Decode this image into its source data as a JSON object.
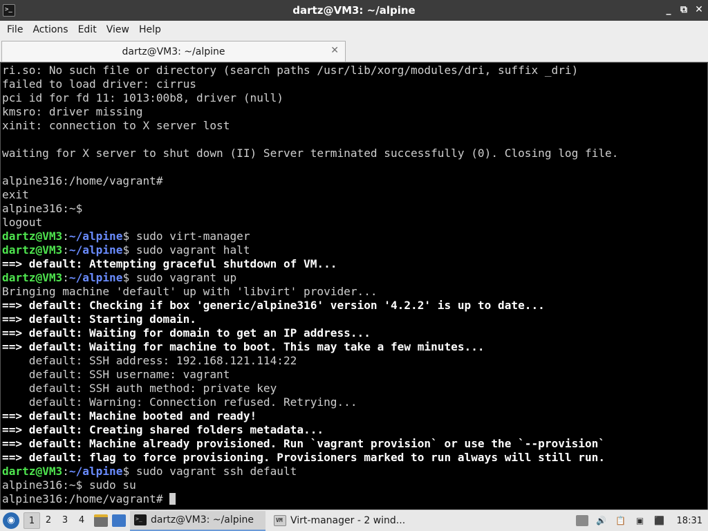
{
  "window": {
    "title": "dartz@VM3: ~/alpine",
    "app_icon_glyph": ">_",
    "controls": [
      "_",
      "⧉",
      "✕"
    ]
  },
  "menu": [
    "File",
    "Actions",
    "Edit",
    "View",
    "Help"
  ],
  "tab": {
    "label": "dartz@VM3: ~/alpine",
    "close": "✕"
  },
  "terminal": {
    "lines": [
      {
        "style": "plain",
        "text": "ri.so: No such file or directory (search paths /usr/lib/xorg/modules/dri, suffix _dri)"
      },
      {
        "style": "plain",
        "text": "failed to load driver: cirrus"
      },
      {
        "style": "plain",
        "text": "pci id for fd 11: 1013:00b8, driver (null)"
      },
      {
        "style": "plain",
        "text": "kmsro: driver missing"
      },
      {
        "style": "plain",
        "text": "xinit: connection to X server lost"
      },
      {
        "style": "plain",
        "text": ""
      },
      {
        "style": "plain",
        "text": "waiting for X server to shut down (II) Server terminated successfully (0). Closing log file."
      },
      {
        "style": "plain",
        "text": ""
      },
      {
        "style": "plain",
        "text": "alpine316:/home/vagrant#"
      },
      {
        "style": "plain",
        "text": "exit"
      },
      {
        "style": "plain",
        "text": "alpine316:~$"
      },
      {
        "style": "plain",
        "text": "logout"
      },
      {
        "style": "prompt",
        "user": "dartz@VM3",
        "path": "~/alpine",
        "cmd": "$ sudo virt-manager"
      },
      {
        "style": "prompt",
        "user": "dartz@VM3",
        "path": "~/alpine",
        "cmd": "$ sudo vagrant halt"
      },
      {
        "style": "bold",
        "text": "==> default: Attempting graceful shutdown of VM..."
      },
      {
        "style": "prompt",
        "user": "dartz@VM3",
        "path": "~/alpine",
        "cmd": "$ sudo vagrant up"
      },
      {
        "style": "plain",
        "text": "Bringing machine 'default' up with 'libvirt' provider..."
      },
      {
        "style": "bold",
        "text": "==> default: Checking if box 'generic/alpine316' version '4.2.2' is up to date..."
      },
      {
        "style": "bold",
        "text": "==> default: Starting domain."
      },
      {
        "style": "bold",
        "text": "==> default: Waiting for domain to get an IP address..."
      },
      {
        "style": "bold",
        "text": "==> default: Waiting for machine to boot. This may take a few minutes..."
      },
      {
        "style": "plain",
        "text": "    default: SSH address: 192.168.121.114:22"
      },
      {
        "style": "plain",
        "text": "    default: SSH username: vagrant"
      },
      {
        "style": "plain",
        "text": "    default: SSH auth method: private key"
      },
      {
        "style": "plain",
        "text": "    default: Warning: Connection refused. Retrying..."
      },
      {
        "style": "bold",
        "text": "==> default: Machine booted and ready!"
      },
      {
        "style": "bold",
        "text": "==> default: Creating shared folders metadata..."
      },
      {
        "style": "bold",
        "text": "==> default: Machine already provisioned. Run `vagrant provision` or use the `--provision`"
      },
      {
        "style": "bold",
        "text": "==> default: flag to force provisioning. Provisioners marked to run always will still run."
      },
      {
        "style": "prompt",
        "user": "dartz@VM3",
        "path": "~/alpine",
        "cmd": "$ sudo vagrant ssh default"
      },
      {
        "style": "plain",
        "text": "alpine316:~$ sudo su"
      },
      {
        "style": "cursor",
        "text": "alpine316:/home/vagrant# "
      }
    ]
  },
  "taskbar": {
    "workspaces": [
      "1",
      "2",
      "3",
      "4"
    ],
    "active_workspace": "1",
    "tasks": [
      {
        "label": "dartz@VM3: ~/alpine",
        "icon": "terminal-icon",
        "glyph": ">_",
        "active": true
      },
      {
        "label": "Virt-manager - 2 wind...",
        "icon": "virt-manager-icon",
        "glyph": "VM",
        "active": false
      }
    ],
    "clock": "18:31"
  },
  "colors": {
    "terminal_bg": "#000000",
    "prompt_user": "#4ee44e",
    "prompt_path": "#6a8cff",
    "titlebar": "#3c3c3c"
  }
}
